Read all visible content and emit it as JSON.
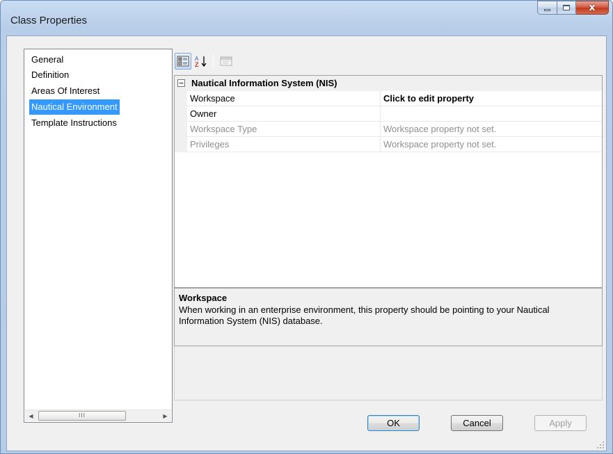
{
  "window": {
    "title": "Class Properties",
    "caption_close": "x"
  },
  "nav": {
    "items": [
      {
        "label": "General",
        "selected": false
      },
      {
        "label": "Definition",
        "selected": false
      },
      {
        "label": "Areas Of Interest",
        "selected": false
      },
      {
        "label": "Nautical Environment",
        "selected": true
      },
      {
        "label": "Template Instructions",
        "selected": false
      }
    ],
    "scroll_grip": "III"
  },
  "toolbar": {
    "buttons": [
      {
        "name": "categorized-icon",
        "active": true
      },
      {
        "name": "alphabetical-sort-icon",
        "active": false
      },
      {
        "name": "property-pages-icon",
        "active": false
      }
    ]
  },
  "property_grid": {
    "category": {
      "label": "Nautical Information System (NIS)",
      "expander": "−"
    },
    "rows": [
      {
        "name": "Workspace",
        "value": "Click to edit property",
        "disabled": false,
        "bold_value": true
      },
      {
        "name": "Owner",
        "value": "",
        "disabled": false,
        "bold_value": false
      },
      {
        "name": "Workspace Type",
        "value": "Workspace property not set.",
        "disabled": true,
        "bold_value": false
      },
      {
        "name": "Privileges",
        "value": "Workspace property not set.",
        "disabled": true,
        "bold_value": false
      }
    ]
  },
  "description": {
    "title": "Workspace",
    "text": "When working in an enterprise environment, this property should be pointing to your Nautical Information System (NIS) database."
  },
  "buttons": {
    "ok": "OK",
    "cancel": "Cancel",
    "apply": "Apply"
  },
  "colors": {
    "selection": "#3399ff",
    "disabled_text": "#8f8f8f"
  }
}
